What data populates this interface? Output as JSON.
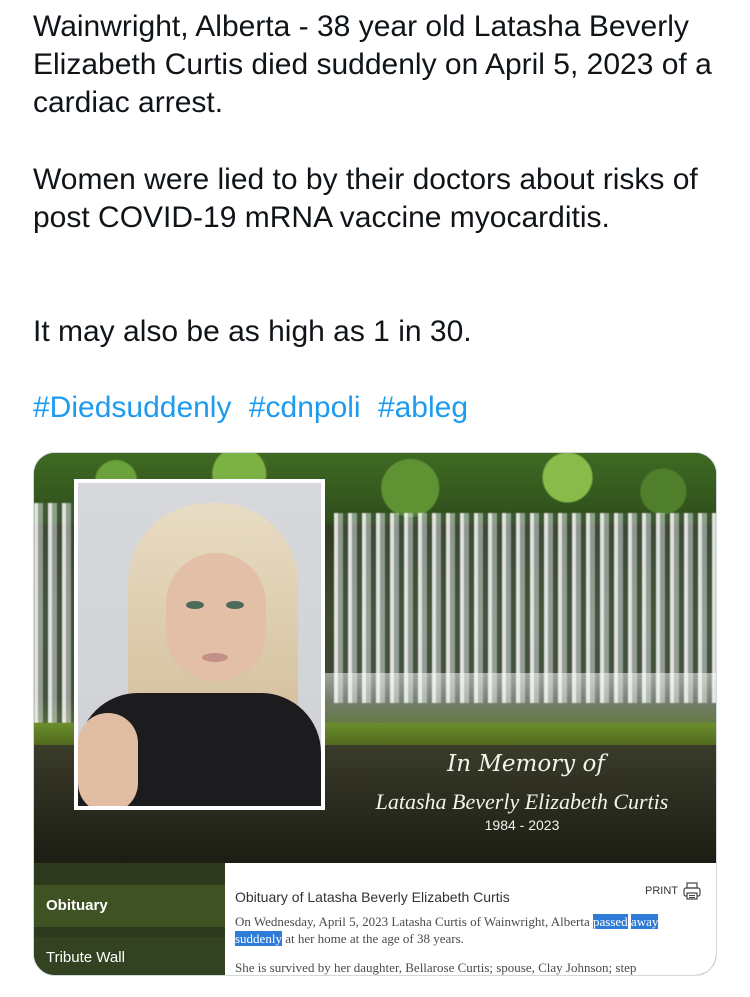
{
  "tweet": {
    "line1": "Wainwright, Alberta - 38 year old Latasha Beverly Elizabeth Curtis died suddenly on April 5, 2023 of a cardiac arrest.",
    "line2": "Women were lied to by their doctors about risks of post COVID-19 mRNA vaccine myocarditis.",
    "line3": "It may also be as high as 1 in 30.",
    "hashtags": [
      "#Diedsuddenly",
      "#cdnpoli",
      "#ableg"
    ]
  },
  "card": {
    "memory_title": "In Memory of",
    "name": "Latasha Beverly Elizabeth Curtis",
    "years": "1984 - 2023",
    "sidebar": [
      {
        "label": "Obituary"
      },
      {
        "label": "Tribute Wall"
      }
    ],
    "obituary_title": "Obituary of Latasha Beverly Elizabeth Curtis",
    "print_label": "PRINT",
    "body_pre": "On Wednesday, April 5, 2023 Latasha Curtis of Wainwright, Alberta ",
    "body_highlight_1": "passed",
    "body_highlight_2": "away suddenly",
    "body_post": " at her home at the age of 38 years.",
    "body_line2": "She is survived by her daughter, Bellarose Curtis; spouse, Clay Johnson; step"
  },
  "colors": {
    "hashtag": "#1d9bf0",
    "highlight": "#2f7bd8"
  }
}
